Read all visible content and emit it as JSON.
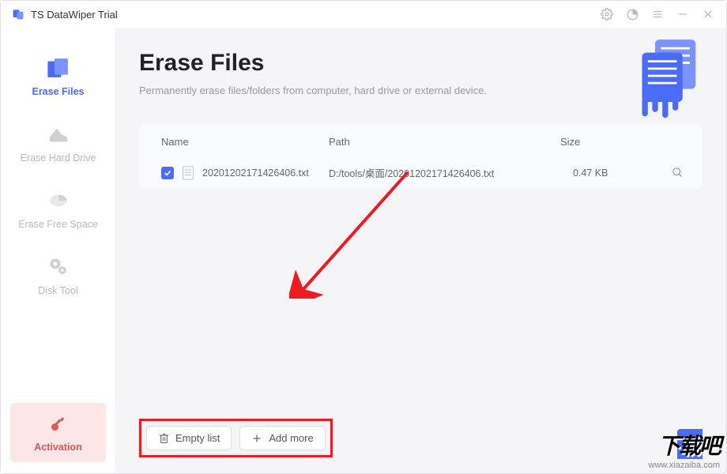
{
  "window": {
    "title": "TS DataWiper Trial"
  },
  "sidebar": {
    "items": [
      {
        "label": "Erase Files"
      },
      {
        "label": "Erase Hard Drive"
      },
      {
        "label": "Erase Free Space"
      },
      {
        "label": "Disk Tool"
      }
    ],
    "activation_label": "Activation"
  },
  "page": {
    "title": "Erase Files",
    "subtitle": "Permanently erase files/folders from computer, hard drive or external device."
  },
  "list": {
    "headers": {
      "name": "Name",
      "path": "Path",
      "size": "Size"
    },
    "rows": [
      {
        "name": "20201202171426406.txt",
        "path": "D:/tools/桌面/20201202171426406.txt",
        "size": "0.47 KB",
        "checked": true
      }
    ]
  },
  "buttons": {
    "empty_list": "Empty list",
    "add_more": "Add more"
  },
  "watermark": {
    "logo": "下载吧",
    "url": "www.xiazaiba.com"
  },
  "colors": {
    "accent": "#4a6cf7",
    "danger": "#e05555",
    "annotation": "#ed1c24"
  }
}
